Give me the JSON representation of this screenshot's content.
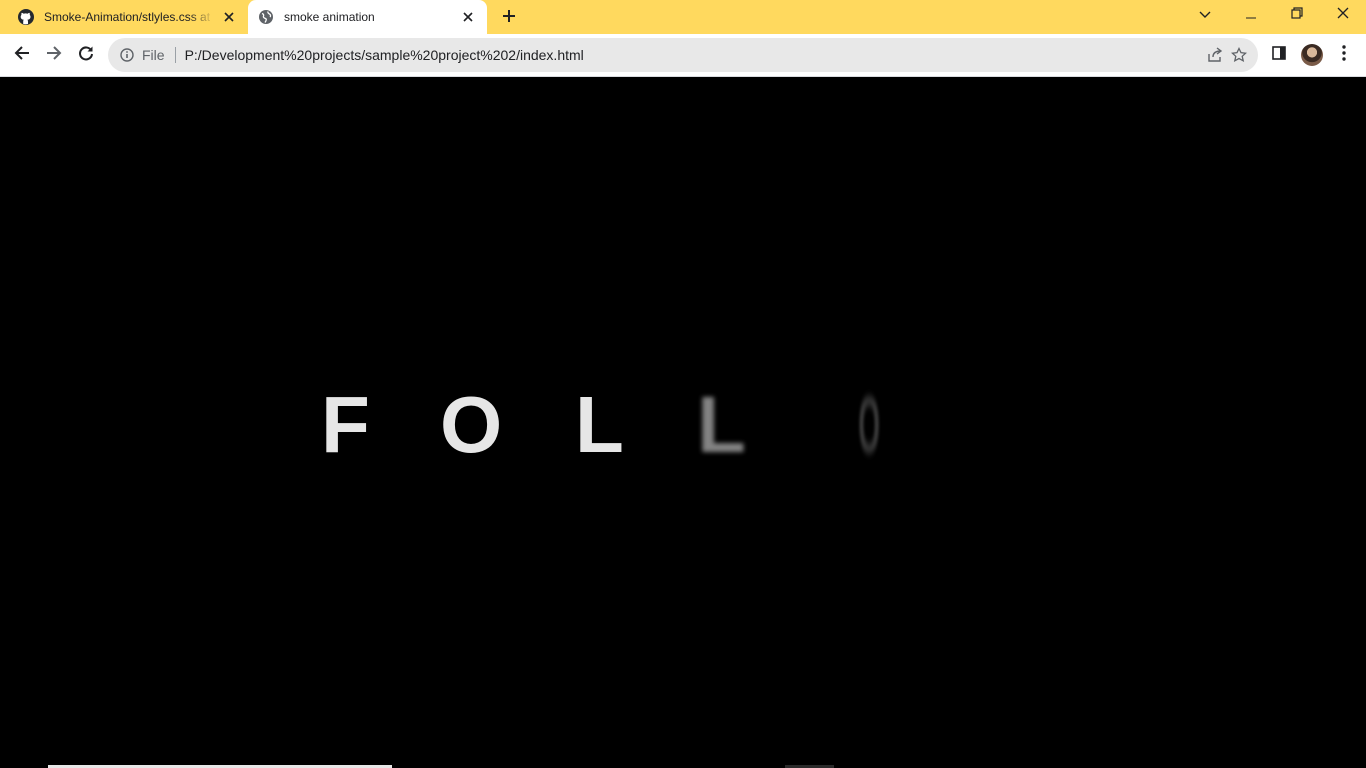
{
  "tabs": [
    {
      "title": "Smoke-Animation/stlyles.css at main",
      "active": false,
      "icon": "github-icon"
    },
    {
      "title": "smoke animation",
      "active": true,
      "icon": "globe-icon"
    }
  ],
  "toolbar": {
    "scheme": "File",
    "url": "P:/Development%20projects/sample%20project%202/index.html"
  },
  "page": {
    "letters": [
      "F",
      "O",
      "L",
      "L",
      "O"
    ]
  },
  "colors": {
    "tabstrip": "#ffd95e",
    "page_background": "#000000",
    "text": "#e6e6e6"
  }
}
